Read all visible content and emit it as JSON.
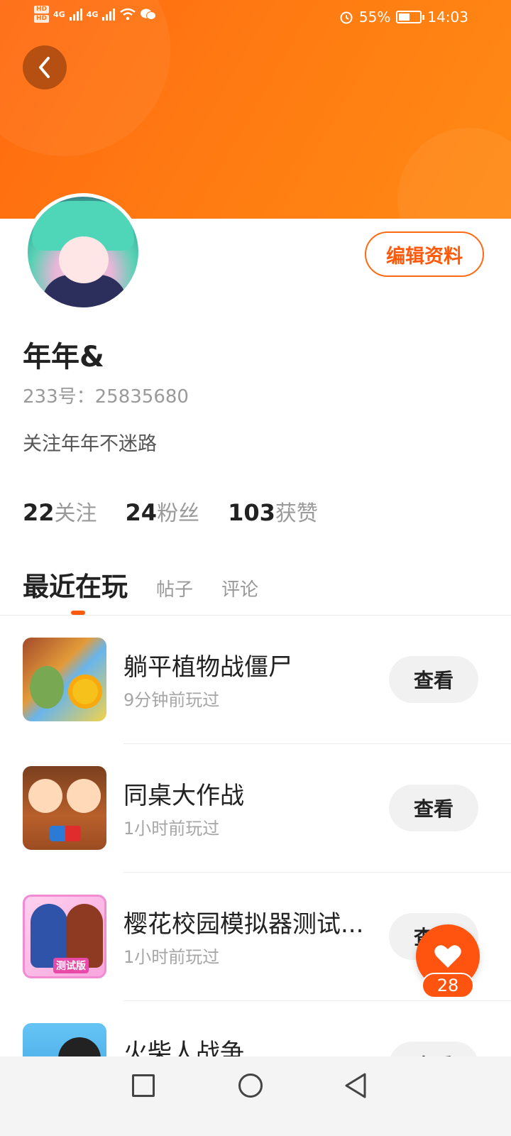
{
  "status_bar": {
    "hd_labels": [
      "HD",
      "HD"
    ],
    "network_labels": [
      "4G",
      "4G"
    ],
    "battery_percent": "55%",
    "time": "14:03",
    "battery_level": 0.55
  },
  "profile": {
    "name": "年年&",
    "uid": "233号：25835680",
    "bio": "关注年年不迷路",
    "edit_label": "编辑资料",
    "stats": [
      {
        "num": "22",
        "label": "关注"
      },
      {
        "num": "24",
        "label": "粉丝"
      },
      {
        "num": "103",
        "label": "获赞"
      }
    ]
  },
  "tabs": [
    "最近在玩",
    "帖子",
    "评论"
  ],
  "games": [
    {
      "title": "躺平植物战僵尸",
      "subtitle": "9分钟前玩过",
      "button": "查看"
    },
    {
      "title": "同桌大作战",
      "subtitle": "1小时前玩过",
      "button": "查看"
    },
    {
      "title": "樱花校园模拟器测试...",
      "subtitle": "1小时前玩过",
      "button": "查看",
      "icon_tag": "测试版"
    },
    {
      "title": "火柴人战争",
      "subtitle": "",
      "button": "查看"
    }
  ],
  "like": {
    "count": "28"
  },
  "colors": {
    "accent": "#ff5a0c",
    "banner": "#ff7a12"
  },
  "icons": {
    "back": "chevron-left-icon",
    "like": "heart-icon",
    "nav_recent": "square-icon",
    "nav_home": "circle-icon",
    "nav_back": "triangle-back-icon"
  }
}
